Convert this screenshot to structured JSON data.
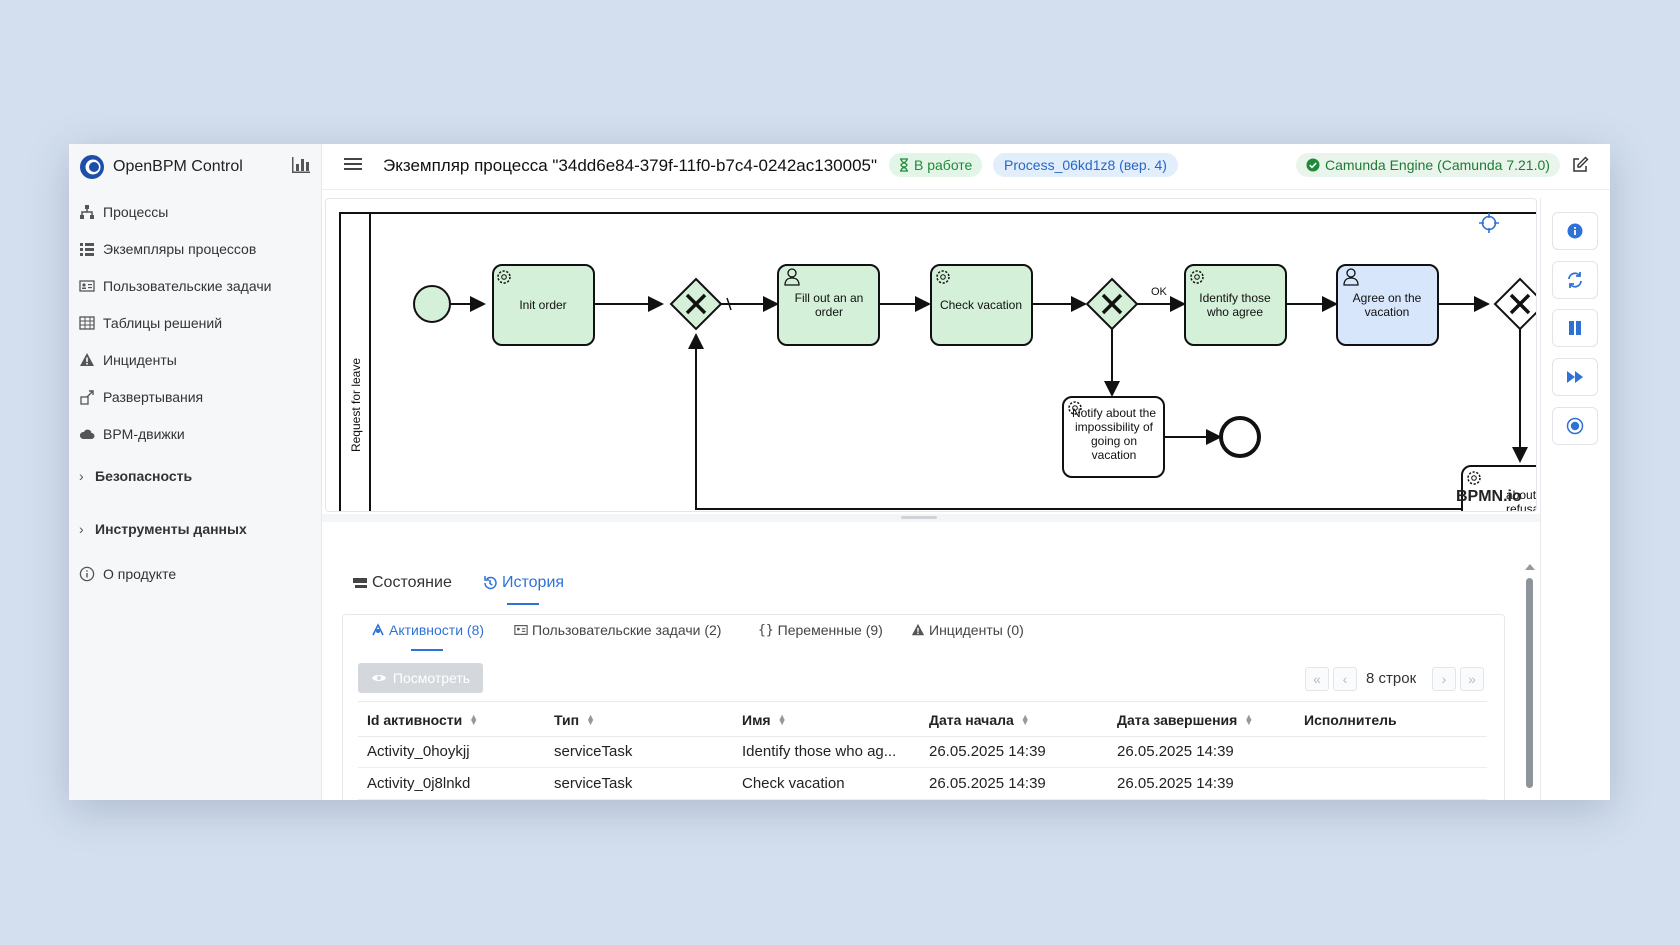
{
  "app": {
    "name": "OpenBPM Control"
  },
  "sidebar": {
    "items": [
      {
        "label": "Процессы",
        "icon": "sitemap-icon"
      },
      {
        "label": "Экземпляры процессов",
        "icon": "list-icon"
      },
      {
        "label": "Пользовательские задачи",
        "icon": "id-card-icon"
      },
      {
        "label": "Таблицы решений",
        "icon": "table-icon"
      },
      {
        "label": "Инциденты",
        "icon": "warning-icon"
      },
      {
        "label": "Развертывания",
        "icon": "deploy-icon"
      },
      {
        "label": "BPM-движки",
        "icon": "cloud-icon"
      }
    ],
    "groups": [
      {
        "label": "Безопасность"
      },
      {
        "label": "Инструменты данных"
      }
    ],
    "about": {
      "label": "О продукте"
    }
  },
  "header": {
    "title": "Экземпляр процесса \"34dd6e84-379f-11f0-b7c4-0242ac130005\"",
    "status_badge": "В работе",
    "process_badge": "Process_06kd1z8 (вер. 4)",
    "engine_badge": "Camunda Engine (Camunda 7.21.0)"
  },
  "diagram": {
    "lane_label": "Request for leave",
    "tasks": {
      "init_order": "Init order",
      "fill_order_1": "Fill out an an",
      "fill_order_2": "order",
      "check_vacation": "Check vacation",
      "identify_1": "Identify those",
      "identify_2": "who agree",
      "agree_1": "Agree on the",
      "agree_2": "vacation",
      "notify_1": "Notify about the",
      "notify_2": "impossibility of",
      "notify_3": "going on",
      "notify_4": "vacation",
      "notify_refusal_1": "about",
      "notify_refusal_2": "refusal"
    },
    "flow_label_ok": "OK",
    "watermark": "BPMN.io"
  },
  "tabs": {
    "state": "Состояние",
    "history": "История"
  },
  "subtabs": {
    "activities": "Активности (8)",
    "user_tasks": "Пользовательские задачи (2)",
    "variables": "Переменные (9)",
    "incidents": "Инциденты (0)"
  },
  "toolbar": {
    "view_label": "Посмотреть",
    "row_count": "8 строк"
  },
  "table": {
    "headers": [
      "Id активности",
      "Тип",
      "Имя",
      "Дата начала",
      "Дата завершения",
      "Исполнитель"
    ],
    "rows": [
      [
        "Activity_0hoykjj",
        "serviceTask",
        "Identify those who ag...",
        "26.05.2025 14:39",
        "26.05.2025 14:39",
        ""
      ],
      [
        "Activity_0j8lnkd",
        "serviceTask",
        "Check vacation",
        "26.05.2025 14:39",
        "26.05.2025 14:39",
        ""
      ]
    ]
  },
  "colors": {
    "accent": "#2f72d6",
    "task_green": "#d4f0d8",
    "task_blue": "#d7e6fb",
    "status_green": "#1f8a3a"
  }
}
